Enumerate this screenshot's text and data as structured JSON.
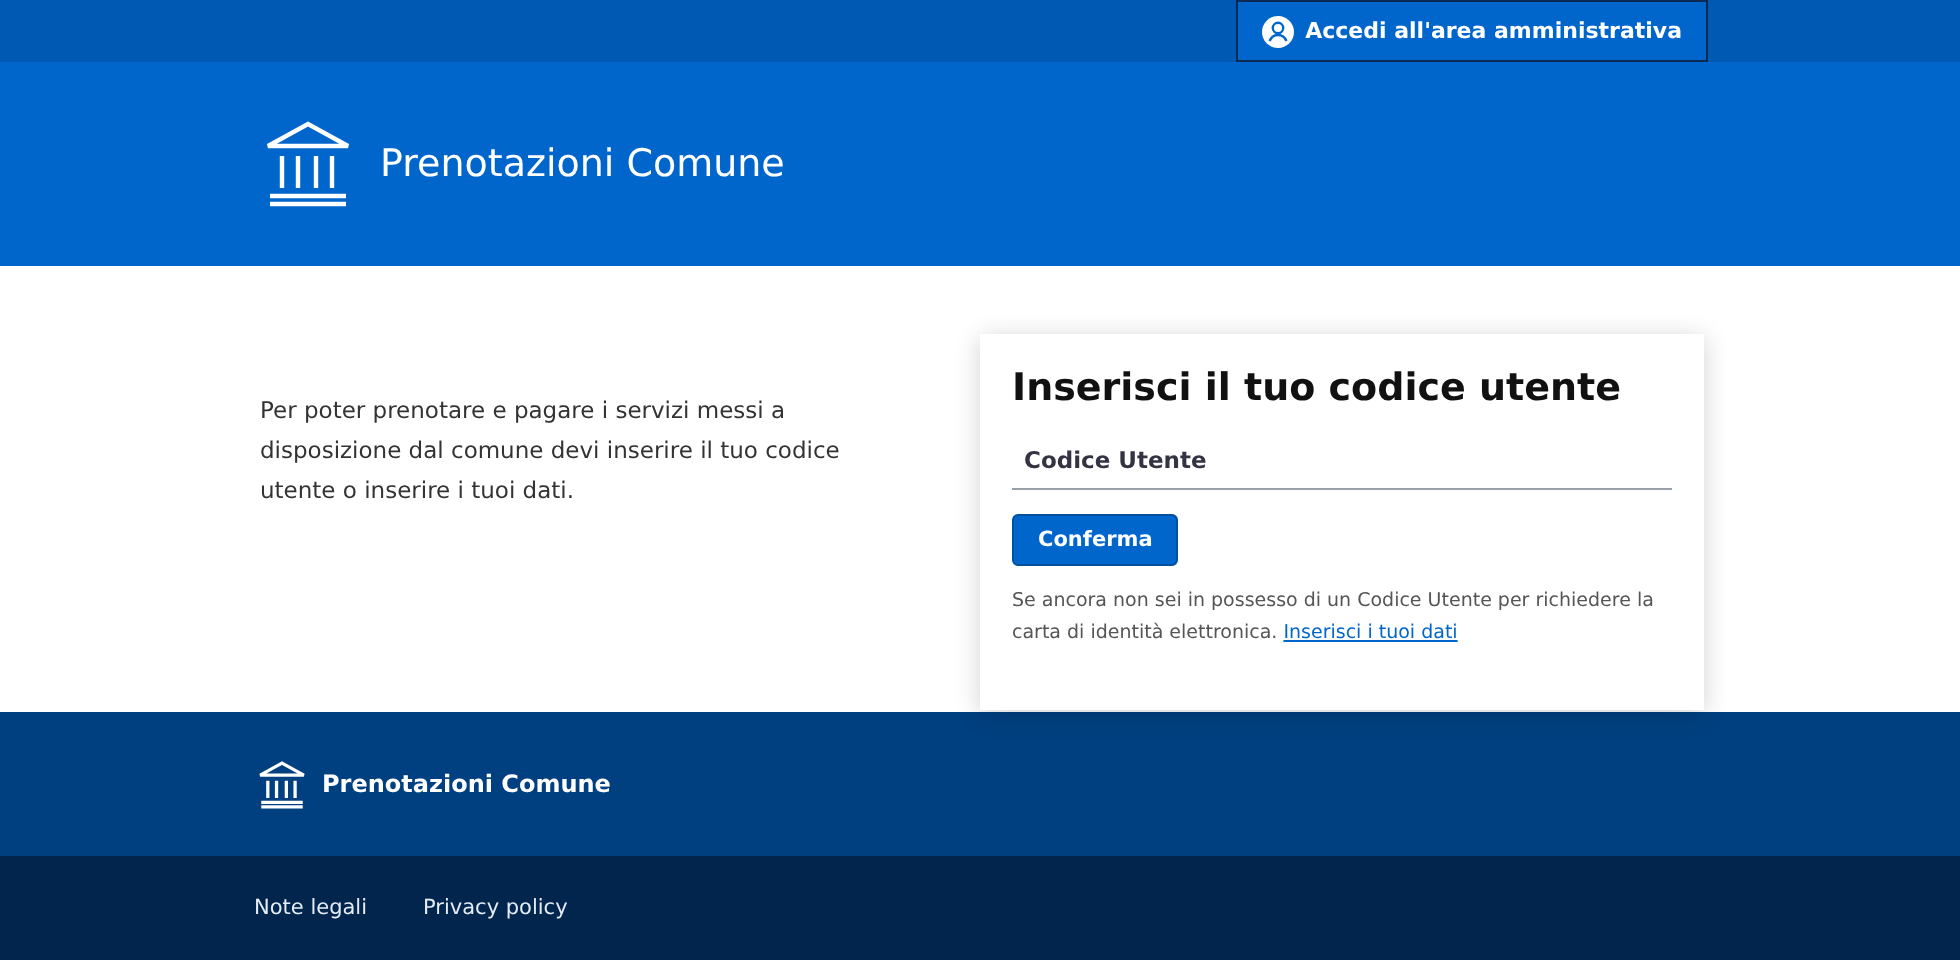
{
  "top_bar": {
    "login_button": "Accedi all'area amministrativa"
  },
  "header": {
    "title": "Prenotazioni Comune"
  },
  "intro": "Per poter prenotare e pagare i servizi messi a disposizione dal comune devi inserire il tuo codice utente o inserire i tuoi dati.",
  "card": {
    "title": "Inserisci il tuo codice utente",
    "field": {
      "placeholder": "Codice Utente"
    },
    "button": "Conferma",
    "note": "Se ancora non sei in possesso di un Codice Utente per richiedere la carta di identità elettronica.",
    "link": "Inserisci i tuoi dati"
  },
  "footer": {
    "title": "Prenotazioni Comune",
    "links": [
      "Note legali",
      "Privacy policy"
    ]
  }
}
